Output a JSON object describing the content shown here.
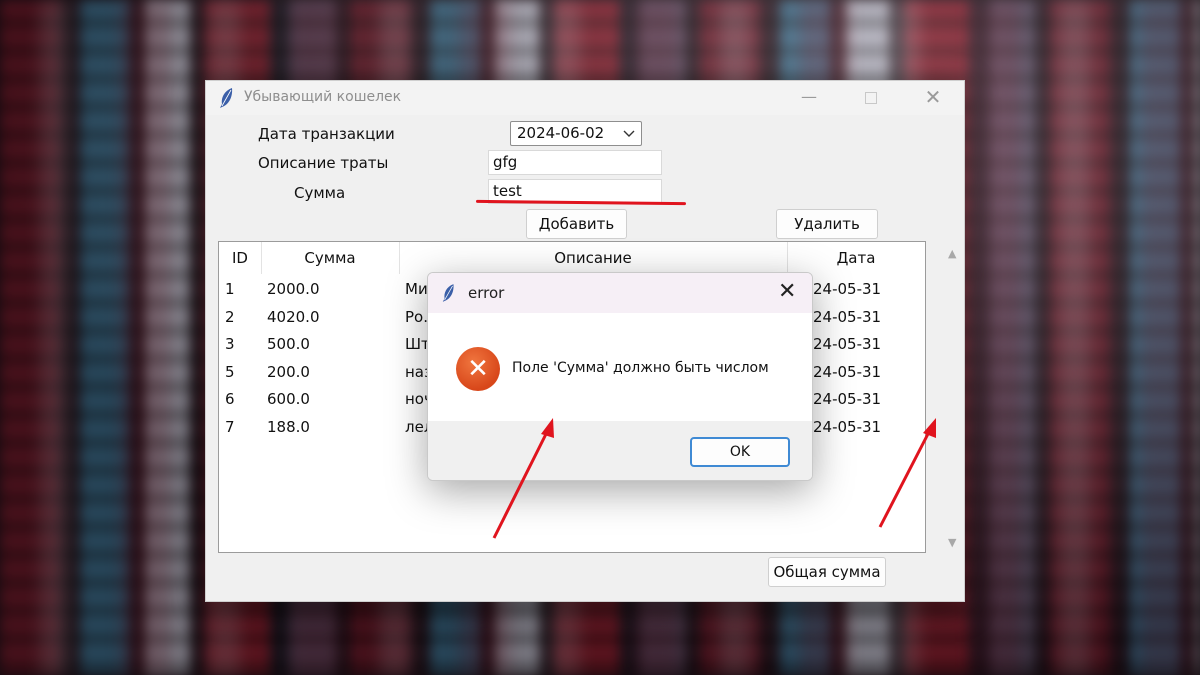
{
  "window": {
    "title": "Убывающий кошелек",
    "minimize": "—",
    "close": "✕"
  },
  "form": {
    "date_label": "Дата транзакции",
    "date_value": "2024-06-02",
    "desc_label": "Описание траты",
    "desc_value": "gfg",
    "sum_label": "Сумма",
    "sum_value": "test",
    "add_button": "Добавить",
    "delete_button": "Удалить",
    "total_button": "Общая сумма"
  },
  "table": {
    "columns": [
      "ID",
      "Сумма",
      "Описание",
      "Дата"
    ],
    "rows": [
      {
        "id": "1",
        "sum": "2000.0",
        "desc": "Ми",
        "date": "24-05-31"
      },
      {
        "id": "2",
        "sum": "4020.0",
        "desc": "Ро.",
        "date": "24-05-31"
      },
      {
        "id": "3",
        "sum": "500.0",
        "desc": "Шт",
        "date": "24-05-31"
      },
      {
        "id": "5",
        "sum": "200.0",
        "desc": "наз",
        "date": "24-05-31"
      },
      {
        "id": "6",
        "sum": "600.0",
        "desc": "ноч",
        "date": "24-05-31"
      },
      {
        "id": "7",
        "sum": "188.0",
        "desc": "лел",
        "date": "24-05-31"
      }
    ]
  },
  "dialog": {
    "title": "error",
    "message": "Поле 'Сумма' должно быть числом",
    "ok": "OK",
    "close": "✕"
  },
  "colors": {
    "annotation": "#e0141e",
    "error_icon": "#e05a22",
    "ok_border": "#3f8ad4"
  }
}
